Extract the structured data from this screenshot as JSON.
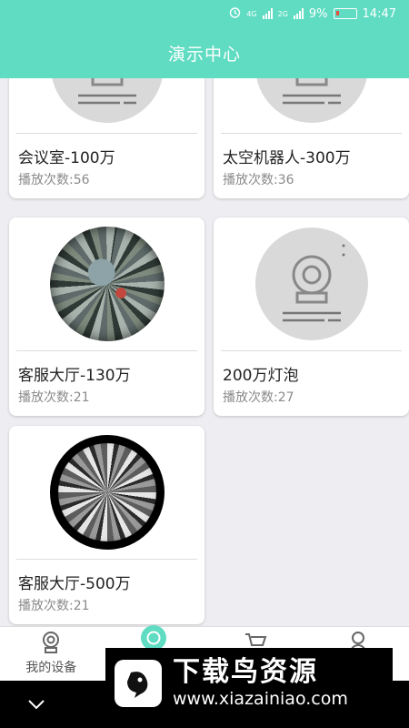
{
  "status_bar": {
    "network_1": "4G",
    "network_2": "2G",
    "battery_percent": "9%",
    "time": "14:47",
    "alarm_icon": "alarm-icon",
    "battery_icon": "battery-low-icon",
    "battery_level": 0.09
  },
  "header": {
    "title": "演示中心"
  },
  "cards": [
    {
      "name": "会议室-100万",
      "plays": "播放次数:56",
      "thumb": "camera-placeholder"
    },
    {
      "name": "太空机器人-300万",
      "plays": "播放次数:36",
      "thumb": "camera-placeholder"
    },
    {
      "name": "客服大厅-130万",
      "plays": "播放次数:21",
      "thumb": "fisheye-office-color"
    },
    {
      "name": "200万灯泡",
      "plays": "播放次数:27",
      "thumb": "camera-placeholder"
    },
    {
      "name": "客服大厅-500万",
      "plays": "播放次数:21",
      "thumb": "fisheye-office-bw"
    }
  ],
  "tabs": [
    {
      "label": "我的设备",
      "icon": "camera-icon",
      "active": false
    },
    {
      "label": "",
      "icon": "demo-circle-icon",
      "active": true
    },
    {
      "label": "",
      "icon": "cart-icon",
      "active": false
    },
    {
      "label": "",
      "icon": "person-icon",
      "active": false
    }
  ],
  "watermark": {
    "title": "下载鸟资源",
    "url": "www.xiazainiao.com"
  },
  "nav_bar": {
    "icon": "chevron-down-icon"
  },
  "colors": {
    "accent": "#5fdcc2",
    "background": "#eeeef2",
    "card": "#ffffff"
  }
}
